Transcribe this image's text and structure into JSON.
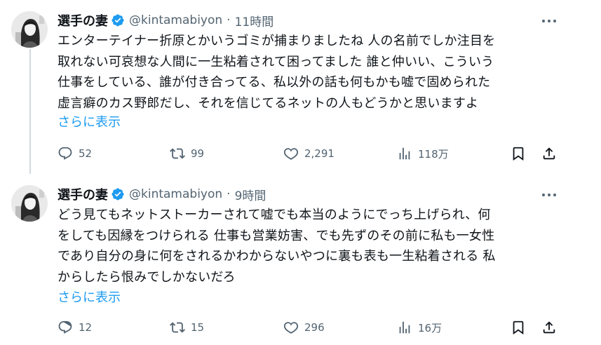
{
  "tweets": [
    {
      "name": "選手の妻",
      "handle": "@kintamabiyon",
      "separator": "·",
      "time": "11時間",
      "lines": [
        "エンターテイナー折原とかいうゴミが捕まりましたね 人の名前でしか注目を",
        "取れない可哀想な人間に一生粘着されて困ってました 誰と仲いい、こういう",
        "仕事をしている、誰が付き合ってる、私以外の話も何もかも嘘で固められた",
        "虚言癖のカス野郎だし、それを信じてるネットの人もどうかと思いますよ"
      ],
      "show_more": "さらに表示",
      "replies": "52",
      "retweets": "99",
      "likes": "2,291",
      "views": "118万"
    },
    {
      "name": "選手の妻",
      "handle": "@kintamabiyon",
      "separator": "·",
      "time": "9時間",
      "lines": [
        "どう見てもネットストーカーされて嘘でも本当のようにでっち上げられ、何",
        "をしても因縁をつけられる 仕事も営業妨害、でも先ずのその前に私も一女性",
        "であり自分の身に何をされるかわからないやつに裏も表も一生粘着される 私",
        "からしたら恨みでしかないだろ"
      ],
      "show_more": "さらに表示",
      "replies": "12",
      "retweets": "15",
      "likes": "296",
      "views": "16万"
    }
  ],
  "colors": {
    "text": "#0f1419",
    "secondary": "#536471",
    "link": "#1d9bf0",
    "verified": "#1d9bf0",
    "thread_line": "#cfd9de"
  },
  "icons": [
    "verified-badge-icon",
    "more-icon",
    "reply-icon",
    "retweet-icon",
    "like-icon",
    "views-icon",
    "bookmark-icon",
    "share-icon"
  ]
}
